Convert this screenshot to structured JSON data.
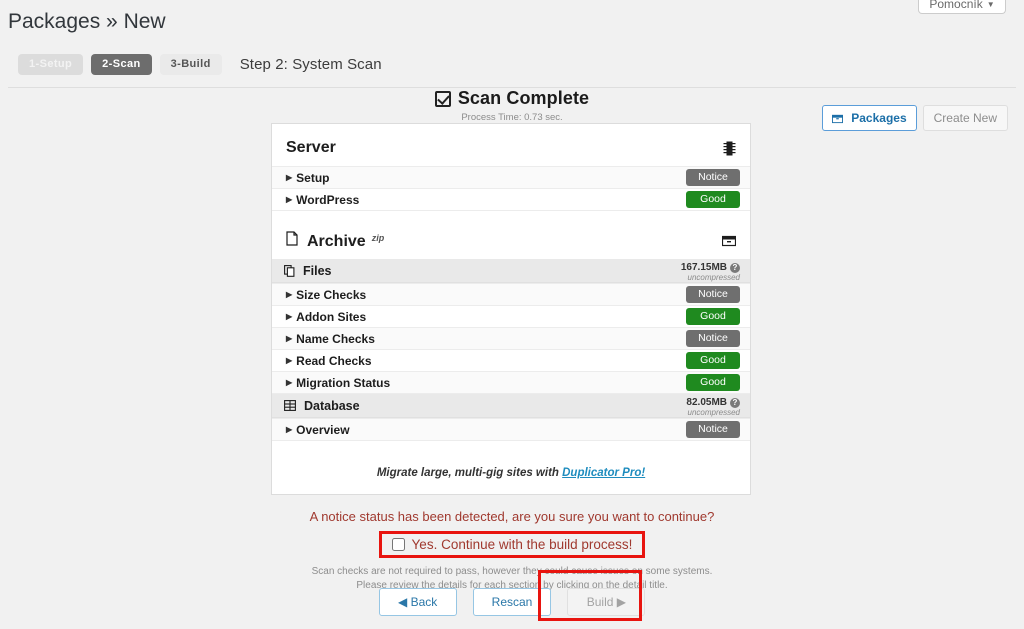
{
  "help_tab": {
    "label": "Pomocník",
    "caret": "▼"
  },
  "page_title": "Packages » New",
  "steps": [
    {
      "label": "1-Setup",
      "state": "done"
    },
    {
      "label": "2-Scan",
      "state": "active"
    },
    {
      "label": "3-Build",
      "state": "next"
    }
  ],
  "step_label": "Step 2: System Scan",
  "header_actions": {
    "packages_label": "Packages",
    "create_new_label": "Create New"
  },
  "scan": {
    "title": "Scan Complete",
    "process_time": "Process Time: 0.73 sec."
  },
  "sections": [
    {
      "name": "Server",
      "sup": "",
      "icon": "server-chip-icon",
      "rows": [
        {
          "title": "Setup",
          "badge": "Notice",
          "status": "notice"
        },
        {
          "title": "WordPress",
          "badge": "Good",
          "status": "good"
        }
      ]
    },
    {
      "name": "Archive",
      "sup": "zip",
      "icon": "archive-box-icon",
      "groups": [
        {
          "title": "Files",
          "icon": "files-copy-icon",
          "size": "167.15MB",
          "size_note": "uncompressed",
          "help": "?",
          "rows": [
            {
              "title": "Size Checks",
              "badge": "Notice",
              "status": "notice"
            },
            {
              "title": "Addon Sites",
              "badge": "Good",
              "status": "good"
            },
            {
              "title": "Name Checks",
              "badge": "Notice",
              "status": "notice"
            },
            {
              "title": "Read Checks",
              "badge": "Good",
              "status": "good"
            },
            {
              "title": "Migration Status",
              "badge": "Good",
              "status": "good"
            }
          ]
        },
        {
          "title": "Database",
          "icon": "database-table-icon",
          "size": "82.05MB",
          "size_note": "uncompressed",
          "help": "?",
          "rows": [
            {
              "title": "Overview",
              "badge": "Notice",
              "status": "notice"
            }
          ]
        }
      ]
    }
  ],
  "promo": {
    "text": "Migrate large, multi-gig sites with ",
    "link": "Duplicator Pro!"
  },
  "notice": {
    "question": "A notice status has been detected, are you sure you want to continue?",
    "consent_label": "Yes. Continue with the build process!",
    "consent_checked": false,
    "fine_line1": "Scan checks are not required to pass, however they could cause issues on some systems.",
    "fine_line2": "Please review the details for each section by clicking on the detail title."
  },
  "buttons": {
    "back": "◀ Back",
    "rescan": "Rescan",
    "build": "Build ▶"
  },
  "colors": {
    "good": "#1f8a1f",
    "notice": "#6f6f6f",
    "link": "#1e8cbe",
    "annotation": "#e8140f",
    "notice_text": "#a0392f"
  }
}
